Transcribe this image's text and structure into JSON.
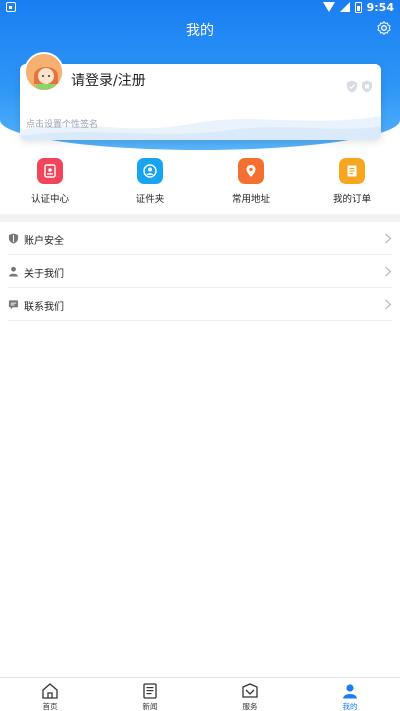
{
  "status_bar": {
    "time": "9:54"
  },
  "header": {
    "title": "我的"
  },
  "profile": {
    "login_text": "请登录/注册",
    "signature_placeholder": "点击设置个性签名"
  },
  "quick_actions": [
    {
      "label": "认证中心",
      "color": "#f0455a",
      "icon": "id-badge-icon"
    },
    {
      "label": "证件夹",
      "color": "#19a4f0",
      "icon": "person-circle-icon"
    },
    {
      "label": "常用地址",
      "color": "#f46f30",
      "icon": "location-pin-icon"
    },
    {
      "label": "我的订单",
      "color": "#f7a622",
      "icon": "order-list-icon"
    }
  ],
  "menu": [
    {
      "label": "账户安全",
      "icon": "shield-icon"
    },
    {
      "label": "关于我们",
      "icon": "person-icon"
    },
    {
      "label": "联系我们",
      "icon": "chat-icon"
    }
  ],
  "tabbar": [
    {
      "label": "首页",
      "icon": "home-icon",
      "active": false
    },
    {
      "label": "新闻",
      "icon": "news-icon",
      "active": false
    },
    {
      "label": "服务",
      "icon": "service-icon",
      "active": false
    },
    {
      "label": "我的",
      "icon": "user-icon",
      "active": true
    }
  ],
  "colors": {
    "accent": "#1a7ef2",
    "header_gradient_top": "#1a7ef2",
    "header_gradient_bottom": "#58b4fa"
  }
}
